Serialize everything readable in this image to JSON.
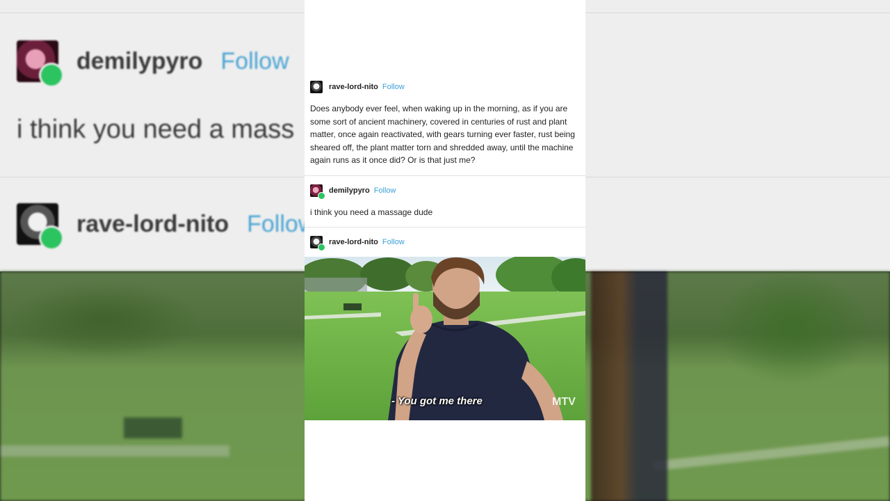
{
  "background": {
    "post1": {
      "username": "demilypyro",
      "follow": "Follow",
      "text": "i think you need a mass"
    },
    "post2": {
      "username": "rave-lord-nito",
      "follow": "Follow"
    }
  },
  "thread": {
    "post1": {
      "username": "rave-lord-nito",
      "follow": "Follow",
      "text": "Does anybody ever feel, when waking up in the morning, as if you are some sort of ancient machinery, covered in centuries of rust and plant matter, once again reactivated, with gears turning ever faster, rust being sheared off, the plant matter torn and shredded away, until the machine again runs as it once did? Or is that just me?"
    },
    "post2": {
      "username": "demilypyro",
      "follow": "Follow",
      "text": "i think you need a massage dude"
    },
    "post3": {
      "username": "rave-lord-nito",
      "follow": "Follow",
      "gif_caption": "- You got me there",
      "watermark": "MTV"
    }
  },
  "colors": {
    "follow_link": "#3aa0d8",
    "online_badge": "#2cc461"
  }
}
